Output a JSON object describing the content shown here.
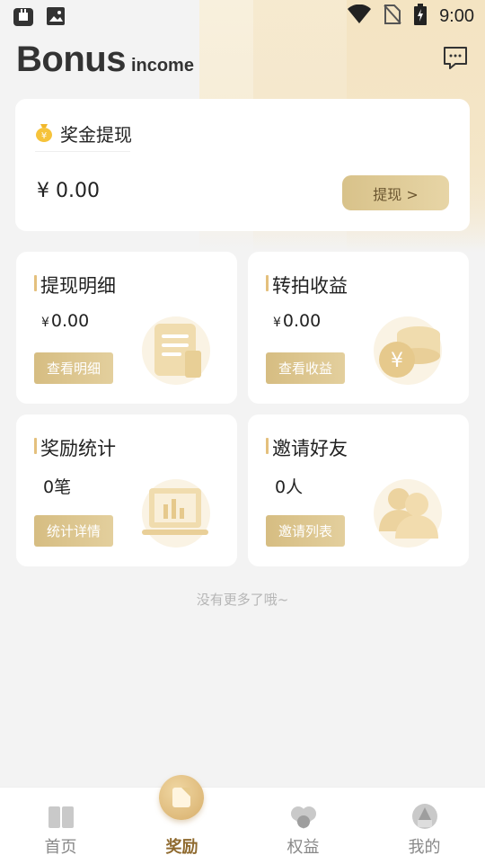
{
  "status_bar": {
    "time": "9:00"
  },
  "header": {
    "title_main": "Bonus",
    "title_sub": "income"
  },
  "withdraw_card": {
    "title": "奖金提现",
    "amount": "¥ 0.00",
    "button": "提现 >"
  },
  "cards": [
    {
      "title": "提现明细",
      "currency": "¥",
      "value": "0.00",
      "button": "查看明细",
      "icon": "document-icon"
    },
    {
      "title": "转拍收益",
      "currency": "¥",
      "value": "0.00",
      "button": "查看收益",
      "icon": "coins-icon"
    },
    {
      "title": "奖励统计",
      "currency": "",
      "value": "0笔",
      "button": "统计详情",
      "icon": "laptop-chart-icon"
    },
    {
      "title": "邀请好友",
      "currency": "",
      "value": "0人",
      "button": "邀请列表",
      "icon": "users-icon"
    }
  ],
  "end_text": "没有更多了哦~",
  "nav": {
    "items": [
      {
        "label": "首页"
      },
      {
        "label": "奖励"
      },
      {
        "label": "权益"
      },
      {
        "label": "我的"
      }
    ],
    "active_color": "#8f6a2f",
    "inactive_color": "#888888"
  },
  "colors": {
    "accent": "#d8c28a",
    "accent_text": "#6b5630",
    "bar": "#e4c07d",
    "background": "#f3f3f3"
  }
}
